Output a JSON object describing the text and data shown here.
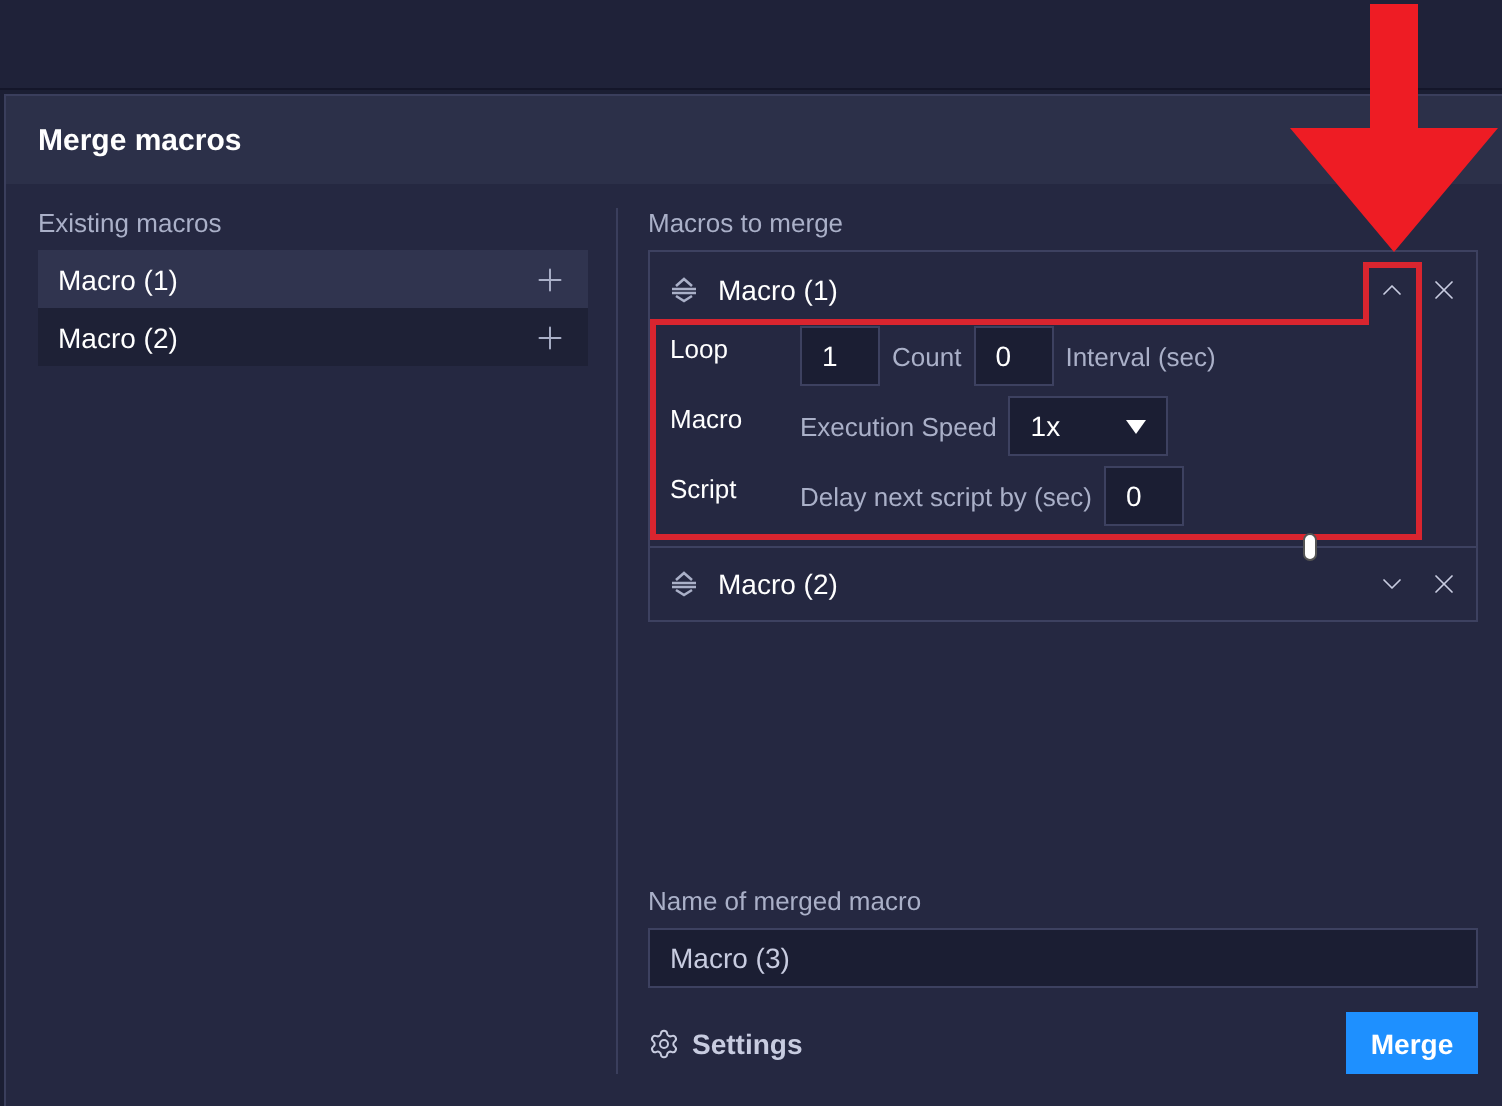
{
  "dialog": {
    "title": "Merge macros",
    "existing": {
      "label": "Existing macros",
      "items": [
        {
          "name": "Macro (1)",
          "selected": true
        },
        {
          "name": "Macro (2)",
          "selected": false
        }
      ]
    },
    "merge": {
      "label": "Macros to merge",
      "items": [
        {
          "name": "Macro (1)",
          "expanded": true,
          "rows": [
            {
              "kind": "loop",
              "label": "Loop",
              "count": "1",
              "count_label": "Count",
              "interval": "0",
              "interval_label": "Interval (sec)"
            },
            {
              "kind": "speed",
              "label": "Macro",
              "speed_label": "Execution Speed",
              "speed": "1x"
            },
            {
              "kind": "delay",
              "label": "Script",
              "delay_label": "Delay next script by (sec)",
              "delay": "0"
            }
          ]
        },
        {
          "name": "Macro (2)",
          "expanded": false
        }
      ]
    },
    "name_field": {
      "label": "Name of merged macro",
      "value": "Macro (3)"
    },
    "settings": "Settings",
    "merge_button": "Merge"
  }
}
